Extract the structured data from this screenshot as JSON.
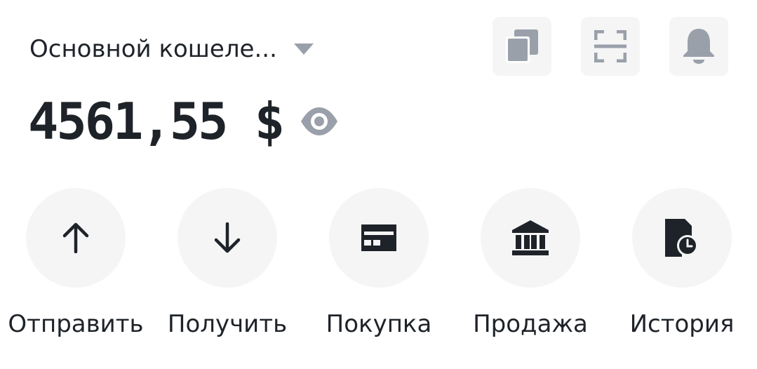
{
  "wallet": {
    "name": "Основной кошеле...",
    "balance": "4561,55 $"
  },
  "header_buttons": [
    {
      "icon": "copy-icon"
    },
    {
      "icon": "scan-icon"
    },
    {
      "icon": "bell-icon"
    }
  ],
  "actions": [
    {
      "label": "Отправить",
      "icon": "arrow-up-icon"
    },
    {
      "label": "Получить",
      "icon": "arrow-down-icon"
    },
    {
      "label": "Покупка",
      "icon": "card-icon"
    },
    {
      "label": "Продажа",
      "icon": "bank-icon"
    },
    {
      "label": "История",
      "icon": "history-icon"
    }
  ],
  "colors": {
    "text": "#1e2329",
    "icon_gray": "#9aa0aa",
    "button_bg": "#f5f5f5"
  }
}
